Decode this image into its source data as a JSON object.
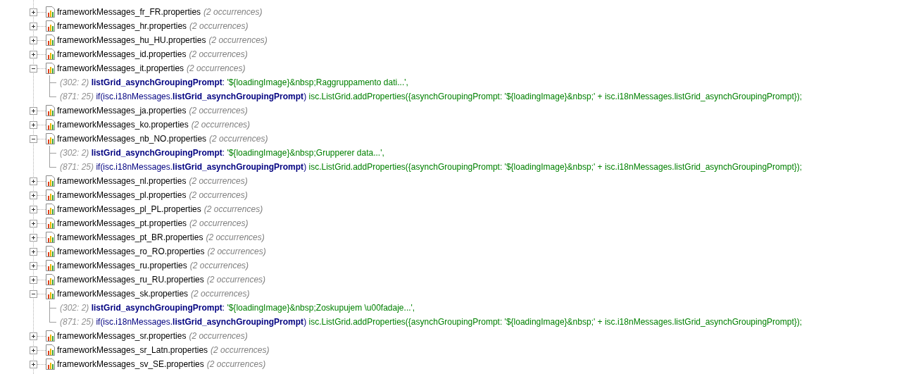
{
  "files": [
    {
      "name": "frameworkMessages_fr_FR.properties",
      "count": "(2 occurrences)",
      "expanded": false
    },
    {
      "name": "frameworkMessages_hr.properties",
      "count": "(2 occurrences)",
      "expanded": false
    },
    {
      "name": "frameworkMessages_hu_HU.properties",
      "count": "(2 occurrences)",
      "expanded": false
    },
    {
      "name": "frameworkMessages_id.properties",
      "count": "(2 occurrences)",
      "expanded": false
    },
    {
      "name": "frameworkMessages_it.properties",
      "count": "(2 occurrences)",
      "expanded": true,
      "matches": [
        {
          "location": "(302: 2)",
          "parts": [
            {
              "kind": "key",
              "text": "listGrid_asynchGroupingPrompt"
            },
            {
              "kind": "code",
              "text": ": "
            },
            {
              "kind": "string",
              "text": "'${loadingImage}&nbsp;Raggruppamento dati...',"
            }
          ]
        },
        {
          "location": "(871: 25)",
          "parts": [
            {
              "kind": "code",
              "text": "if(isc.i18nMessages."
            },
            {
              "kind": "key",
              "text": "listGrid_asynchGroupingPrompt"
            },
            {
              "kind": "code",
              "text": ")"
            },
            {
              "kind": "string",
              "text": " isc.ListGrid.addProperties({asynchGroupingPrompt: '${loadingImage}&nbsp;' + isc.i18nMessages.listGrid_asynchGroupingPrompt});"
            }
          ]
        }
      ]
    },
    {
      "name": "frameworkMessages_ja.properties",
      "count": "(2 occurrences)",
      "expanded": false
    },
    {
      "name": "frameworkMessages_ko.properties",
      "count": "(2 occurrences)",
      "expanded": false
    },
    {
      "name": "frameworkMessages_nb_NO.properties",
      "count": "(2 occurrences)",
      "expanded": true,
      "matches": [
        {
          "location": "(302: 2)",
          "parts": [
            {
              "kind": "key",
              "text": "listGrid_asynchGroupingPrompt"
            },
            {
              "kind": "code",
              "text": ": "
            },
            {
              "kind": "string",
              "text": "'${loadingImage}&nbsp;Grupperer data...',"
            }
          ]
        },
        {
          "location": "(871: 25)",
          "parts": [
            {
              "kind": "code",
              "text": "if(isc.i18nMessages."
            },
            {
              "kind": "key",
              "text": "listGrid_asynchGroupingPrompt"
            },
            {
              "kind": "code",
              "text": ")"
            },
            {
              "kind": "string",
              "text": " isc.ListGrid.addProperties({asynchGroupingPrompt: '${loadingImage}&nbsp;' + isc.i18nMessages.listGrid_asynchGroupingPrompt});"
            }
          ]
        }
      ]
    },
    {
      "name": "frameworkMessages_nl.properties",
      "count": "(2 occurrences)",
      "expanded": false
    },
    {
      "name": "frameworkMessages_pl.properties",
      "count": "(2 occurrences)",
      "expanded": false
    },
    {
      "name": "frameworkMessages_pl_PL.properties",
      "count": "(2 occurrences)",
      "expanded": false
    },
    {
      "name": "frameworkMessages_pt.properties",
      "count": "(2 occurrences)",
      "expanded": false
    },
    {
      "name": "frameworkMessages_pt_BR.properties",
      "count": "(2 occurrences)",
      "expanded": false
    },
    {
      "name": "frameworkMessages_ro_RO.properties",
      "count": "(2 occurrences)",
      "expanded": false
    },
    {
      "name": "frameworkMessages_ru.properties",
      "count": "(2 occurrences)",
      "expanded": false
    },
    {
      "name": "frameworkMessages_ru_RU.properties",
      "count": "(2 occurrences)",
      "expanded": false
    },
    {
      "name": "frameworkMessages_sk.properties",
      "count": "(2 occurrences)",
      "expanded": true,
      "matches": [
        {
          "location": "(302: 2)",
          "parts": [
            {
              "kind": "key",
              "text": "listGrid_asynchGroupingPrompt"
            },
            {
              "kind": "code",
              "text": ": "
            },
            {
              "kind": "string",
              "text": "'${loadingImage}&nbsp;Zoskupujem \\u00fadaje...',"
            }
          ]
        },
        {
          "location": "(871: 25)",
          "parts": [
            {
              "kind": "code",
              "text": "if(isc.i18nMessages."
            },
            {
              "kind": "key",
              "text": "listGrid_asynchGroupingPrompt"
            },
            {
              "kind": "code",
              "text": ")"
            },
            {
              "kind": "string",
              "text": " isc.ListGrid.addProperties({asynchGroupingPrompt: '${loadingImage}&nbsp;' + isc.i18nMessages.listGrid_asynchGroupingPrompt});"
            }
          ]
        }
      ]
    },
    {
      "name": "frameworkMessages_sr.properties",
      "count": "(2 occurrences)",
      "expanded": false
    },
    {
      "name": "frameworkMessages_sr_Latn.properties",
      "count": "(2 occurrences)",
      "expanded": false
    },
    {
      "name": "frameworkMessages_sv_SE.properties",
      "count": "(2 occurrences)",
      "expanded": false
    }
  ]
}
